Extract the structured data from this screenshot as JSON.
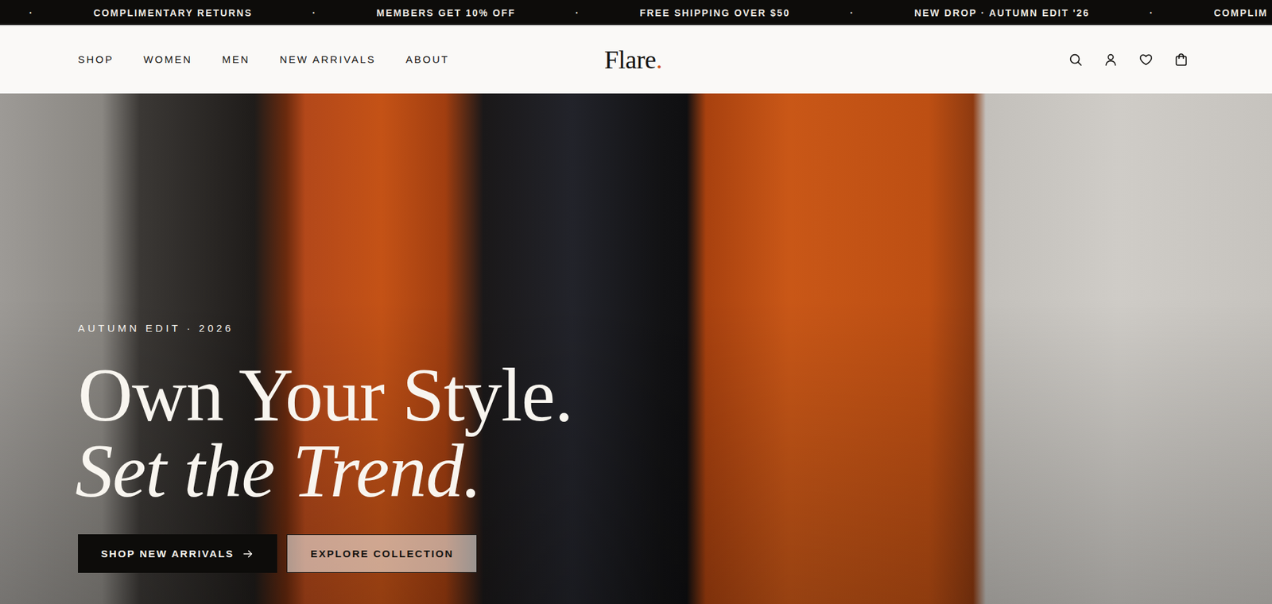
{
  "announcement_bar": {
    "items": [
      "·",
      "COMPLIMENTARY RETURNS",
      "·",
      "MEMBERS GET 10% OFF",
      "·",
      "FREE SHIPPING OVER $50",
      "·",
      "NEW DROP · AUTUMN EDIT '26",
      "·",
      "COMPLIM"
    ]
  },
  "nav": {
    "links": [
      "SHOP",
      "WOMEN",
      "MEN",
      "NEW ARRIVALS",
      "ABOUT"
    ],
    "logo": {
      "text": "Flare",
      "accent": "."
    }
  },
  "hero": {
    "eyebrow": "AUTUMN EDIT · 2026",
    "headline": "Own Your Style.",
    "headline_italic": "Set the Trend.",
    "buttons": [
      {
        "label": "SHOP NEW ARRIVALS",
        "kind": "primary"
      },
      {
        "label": "EXPLORE COLLECTION",
        "kind": "secondary"
      }
    ]
  }
}
